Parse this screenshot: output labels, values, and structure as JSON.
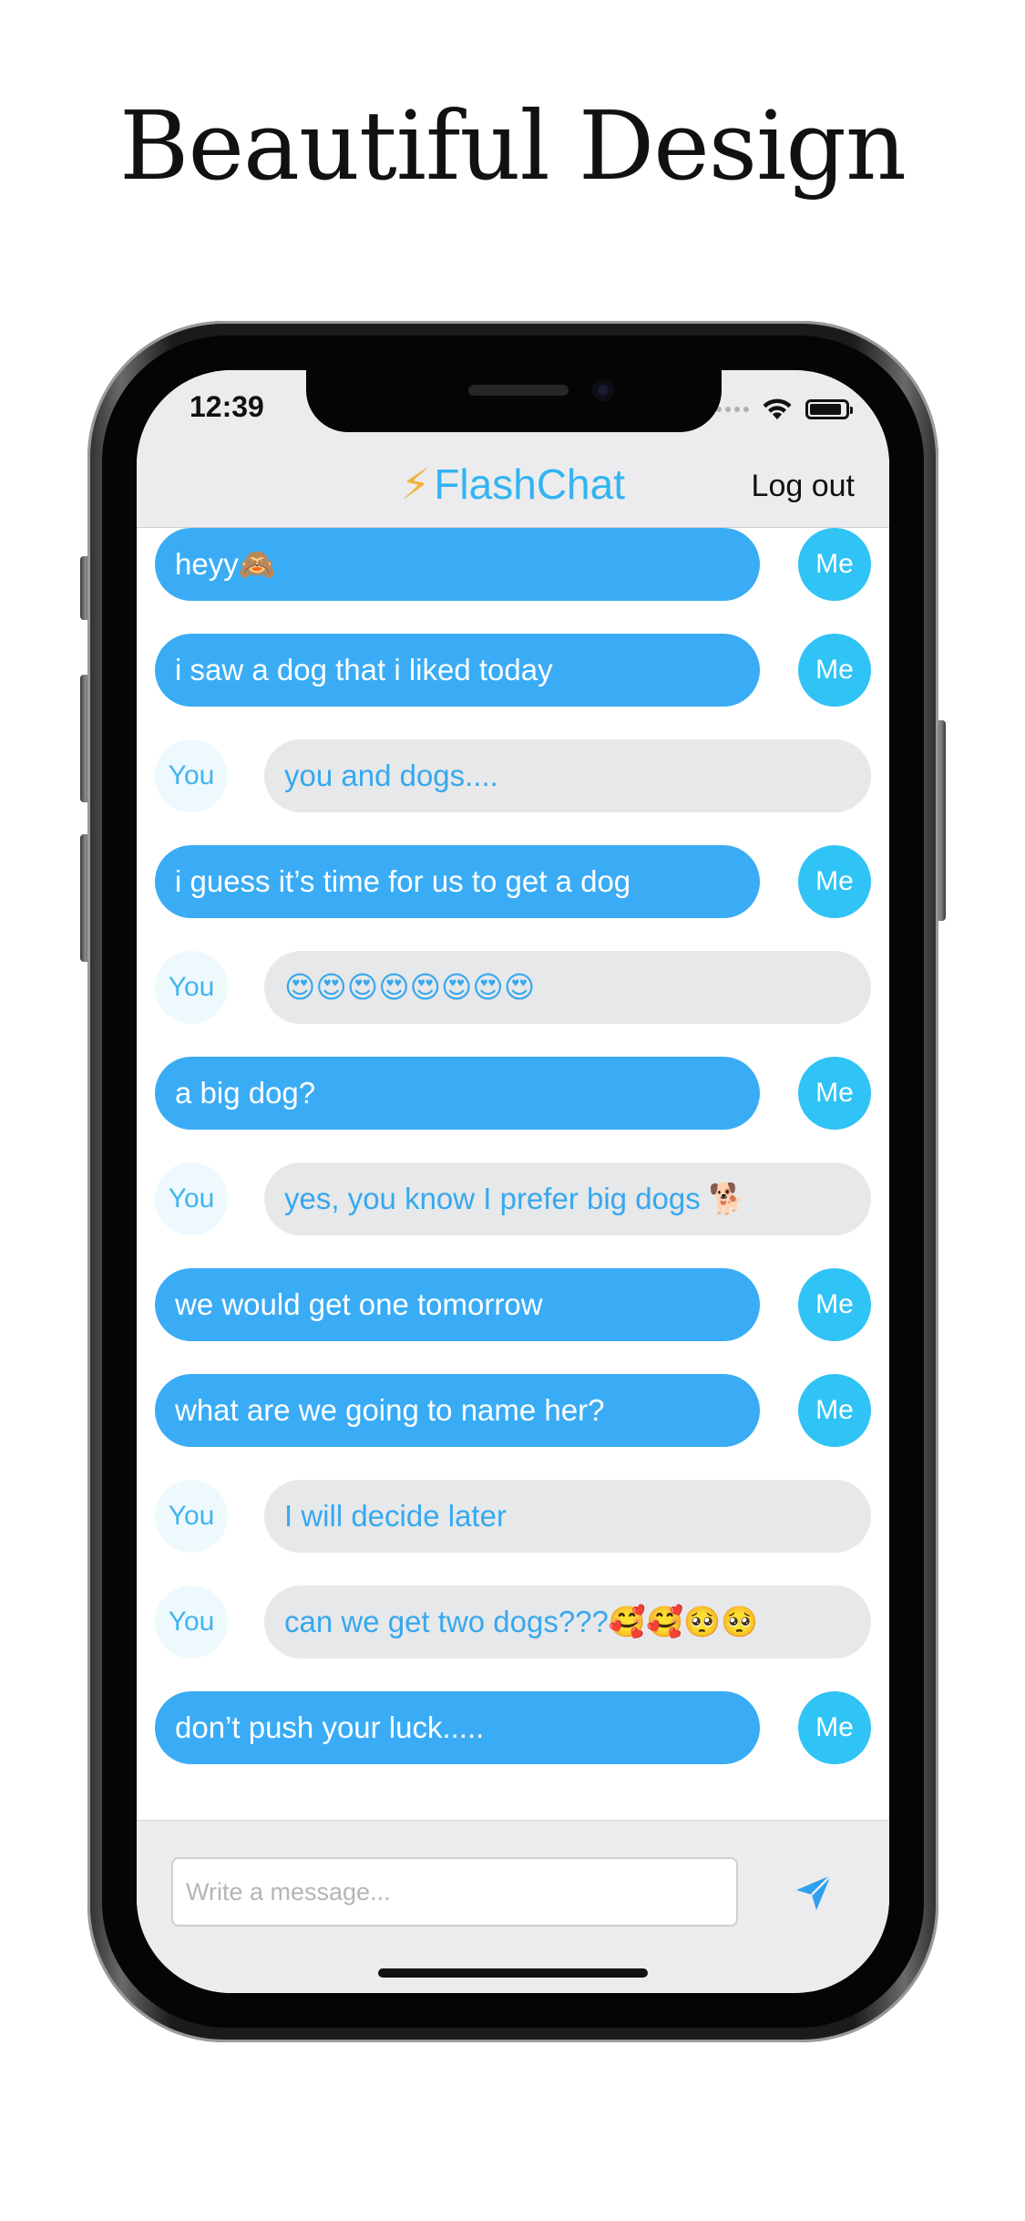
{
  "marketing": {
    "headline": "Beautiful Design"
  },
  "status_bar": {
    "time": "12:39",
    "battery_level": 0.9,
    "icons": [
      "cellular-signal-icon",
      "wifi-icon",
      "battery-icon"
    ]
  },
  "nav": {
    "bolt_icon": "⚡",
    "app_title": "FlashChat",
    "logout_label": "Log out"
  },
  "colors": {
    "me_bubble": "#3aacf5",
    "me_avatar": "#30c3f5",
    "you_bubble": "#e7e8ea",
    "you_text": "#37a8ee",
    "title_accent": "#32b4f2",
    "send_icon": "#2f9ff0"
  },
  "messages": [
    {
      "sender": "me",
      "avatar_label": "Me",
      "text": "heyy🙈"
    },
    {
      "sender": "me",
      "avatar_label": "Me",
      "text": "i saw a dog that i liked today"
    },
    {
      "sender": "you",
      "avatar_label": "You",
      "text": "you and dogs...."
    },
    {
      "sender": "me",
      "avatar_label": "Me",
      "text": "i guess it’s time for us to get a dog"
    },
    {
      "sender": "you",
      "avatar_label": "You",
      "text": "😍😍😍😍😍😍😍😍"
    },
    {
      "sender": "me",
      "avatar_label": "Me",
      "text": "a big dog?"
    },
    {
      "sender": "you",
      "avatar_label": "You",
      "text": "yes, you know I prefer big dogs 🐕"
    },
    {
      "sender": "me",
      "avatar_label": "Me",
      "text": "we would get one tomorrow"
    },
    {
      "sender": "me",
      "avatar_label": "Me",
      "text": "what are we going to name her?"
    },
    {
      "sender": "you",
      "avatar_label": "You",
      "text": "I will decide later"
    },
    {
      "sender": "you",
      "avatar_label": "You",
      "text": "can we get two dogs???🥰🥰🥺🥺"
    },
    {
      "sender": "me",
      "avatar_label": "Me",
      "text": "don’t push your luck....."
    }
  ],
  "composer": {
    "placeholder": "Write a message...",
    "value": "",
    "send_icon": "paper-plane-icon"
  }
}
